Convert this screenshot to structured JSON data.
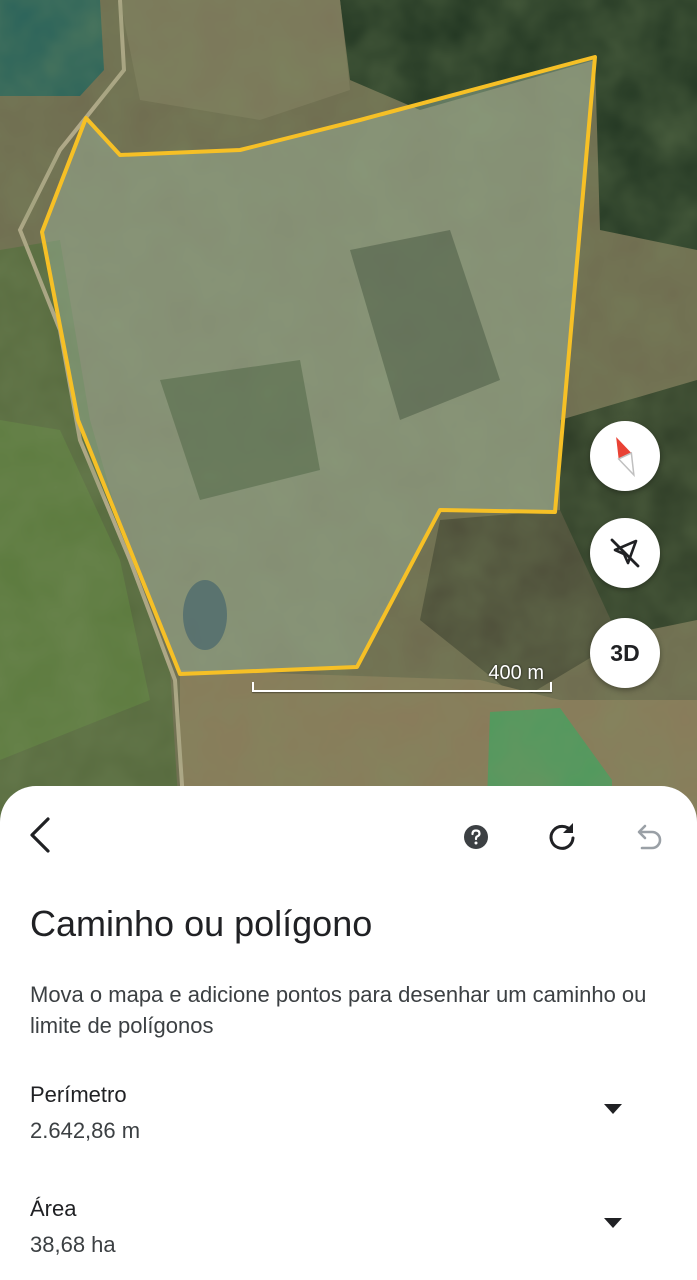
{
  "map": {
    "scale_label": "400 m",
    "compass_icon": "compass-icon",
    "tilt_icon": "location-off-icon",
    "view_3d_label": "3D",
    "polygon_color": "#f6c026"
  },
  "toolbar": {
    "back_icon": "chevron-left-icon",
    "help_icon": "help-icon",
    "reset_icon": "refresh-icon",
    "undo_icon": "undo-icon"
  },
  "panel": {
    "title": "Caminho ou polígono",
    "description": "Mova o mapa e adicione pontos para desenhar um caminho ou limite de polígonos",
    "perimeter": {
      "label": "Perímetro",
      "value": "2.642,86 m"
    },
    "area": {
      "label": "Área",
      "value": "38,68 ha"
    }
  }
}
